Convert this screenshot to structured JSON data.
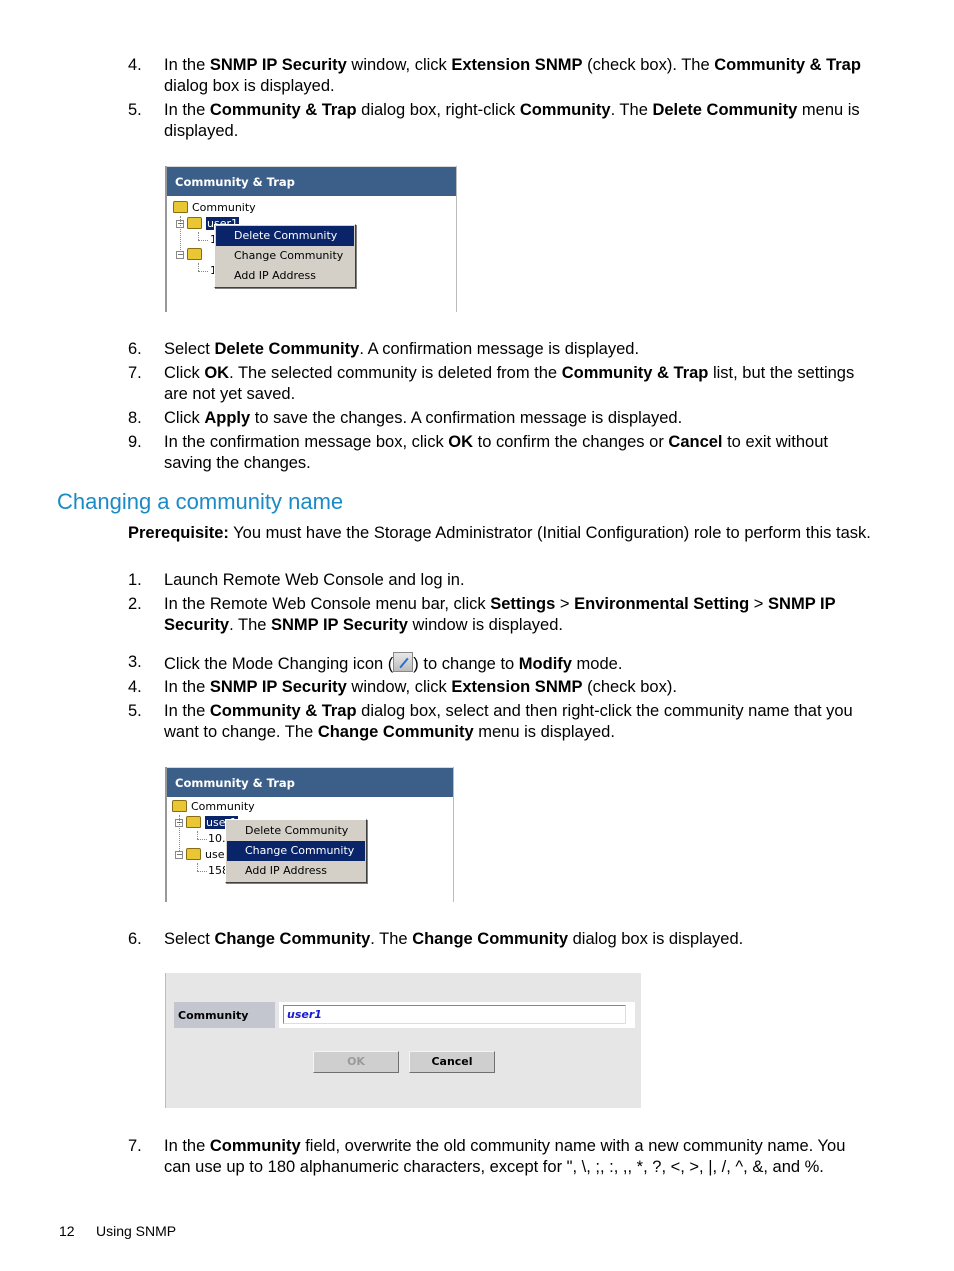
{
  "section1": {
    "steps": [
      {
        "num": "4.",
        "parts": [
          [
            "In the ",
            0
          ],
          [
            "SNMP IP Security",
            1
          ],
          [
            " window, click ",
            0
          ],
          [
            "Extension SNMP",
            1
          ],
          [
            " (check box). The ",
            0
          ],
          [
            "Community & Trap",
            1
          ],
          [
            " dialog box is displayed.",
            0
          ]
        ]
      },
      {
        "num": "5.",
        "parts": [
          [
            "In the ",
            0
          ],
          [
            "Community & Trap",
            1
          ],
          [
            " dialog box, right-click ",
            0
          ],
          [
            "Community",
            1
          ],
          [
            ". The ",
            0
          ],
          [
            "Delete Community",
            1
          ],
          [
            " menu is displayed.",
            0
          ]
        ]
      }
    ],
    "screenshot": {
      "title": "Community & Trap",
      "root": "Community",
      "selected_node": "user1",
      "child1_partial": "1",
      "node2_partial": "",
      "child2_partial": "1",
      "menu": [
        "Delete Community",
        "Change Community",
        "Add IP Address"
      ],
      "active_menu_index": 0
    },
    "steps_after": [
      {
        "num": "6.",
        "parts": [
          [
            "Select ",
            0
          ],
          [
            "Delete Community",
            1
          ],
          [
            ". A confirmation message is displayed.",
            0
          ]
        ]
      },
      {
        "num": "7.",
        "parts": [
          [
            "Click ",
            0
          ],
          [
            "OK",
            1
          ],
          [
            ". The selected community is deleted from the ",
            0
          ],
          [
            "Community & Trap",
            1
          ],
          [
            " list, but the settings are not yet saved.",
            0
          ]
        ]
      },
      {
        "num": "8.",
        "parts": [
          [
            "Click ",
            0
          ],
          [
            "Apply",
            1
          ],
          [
            " to save the changes. A confirmation message is displayed.",
            0
          ]
        ]
      },
      {
        "num": "9.",
        "parts": [
          [
            "In the confirmation message box, click ",
            0
          ],
          [
            "OK",
            1
          ],
          [
            " to confirm the changes or ",
            0
          ],
          [
            "Cancel",
            1
          ],
          [
            " to exit without saving the changes.",
            0
          ]
        ]
      }
    ]
  },
  "section2": {
    "heading": "Changing a community name",
    "prereq_label": "Prerequisite:",
    "prereq_text": " You must have the Storage Administrator (Initial Configuration) role to perform this task.",
    "steps": [
      {
        "num": "1.",
        "parts": [
          [
            "Launch Remote Web Console and log in.",
            0
          ]
        ]
      },
      {
        "num": "2.",
        "parts": [
          [
            "In the Remote Web Console menu bar, click ",
            0
          ],
          [
            "Settings",
            1
          ],
          [
            " > ",
            0
          ],
          [
            "Environmental Setting",
            1
          ],
          [
            " > ",
            0
          ],
          [
            "SNMP IP Security",
            1
          ],
          [
            ". The ",
            0
          ],
          [
            "SNMP IP Security",
            1
          ],
          [
            " window is displayed.",
            0
          ]
        ]
      },
      {
        "num": "3.",
        "parts": [
          [
            "Click the Mode Changing icon (",
            0
          ],
          [
            "[icon]",
            2
          ],
          [
            ") to change to ",
            0
          ],
          [
            "Modify",
            1
          ],
          [
            " mode.",
            0
          ]
        ]
      },
      {
        "num": "4.",
        "parts": [
          [
            "In the ",
            0
          ],
          [
            "SNMP IP Security",
            1
          ],
          [
            " window, click ",
            0
          ],
          [
            "Extension SNMP",
            1
          ],
          [
            " (check box).",
            0
          ]
        ]
      },
      {
        "num": "5.",
        "parts": [
          [
            "In the ",
            0
          ],
          [
            "Community & Trap",
            1
          ],
          [
            " dialog box, select and then right-click the community name that you want to change. The ",
            0
          ],
          [
            "Change Community",
            1
          ],
          [
            " menu is displayed.",
            0
          ]
        ]
      }
    ],
    "screenshot": {
      "title": "Community & Trap",
      "root": "Community",
      "selected_node": "user1",
      "child1_partial": "10.",
      "node2_partial": "use",
      "child2_partial": "158",
      "menu": [
        "Delete Community",
        "Change Community",
        "Add IP Address"
      ],
      "active_menu_index": 1
    },
    "step6": {
      "num": "6.",
      "parts": [
        [
          "Select ",
          0
        ],
        [
          "Change Community",
          1
        ],
        [
          ". The ",
          0
        ],
        [
          "Change Community",
          1
        ],
        [
          " dialog box is displayed.",
          0
        ]
      ]
    },
    "dialog": {
      "label": "Community",
      "value": "user1",
      "ok_label": "OK",
      "cancel_label": "Cancel"
    },
    "step7": {
      "num": "7.",
      "parts": [
        [
          "In the ",
          0
        ],
        [
          "Community",
          1
        ],
        [
          " field, overwrite the old community name with a new community name. You can use up to 180 alphanumeric characters, except for \", \\, ;, :, ,, *, ?, <, >, |, /, ^, &, and %.",
          0
        ]
      ]
    }
  },
  "footer": {
    "page_number": "12",
    "section_title": "Using SNMP"
  }
}
